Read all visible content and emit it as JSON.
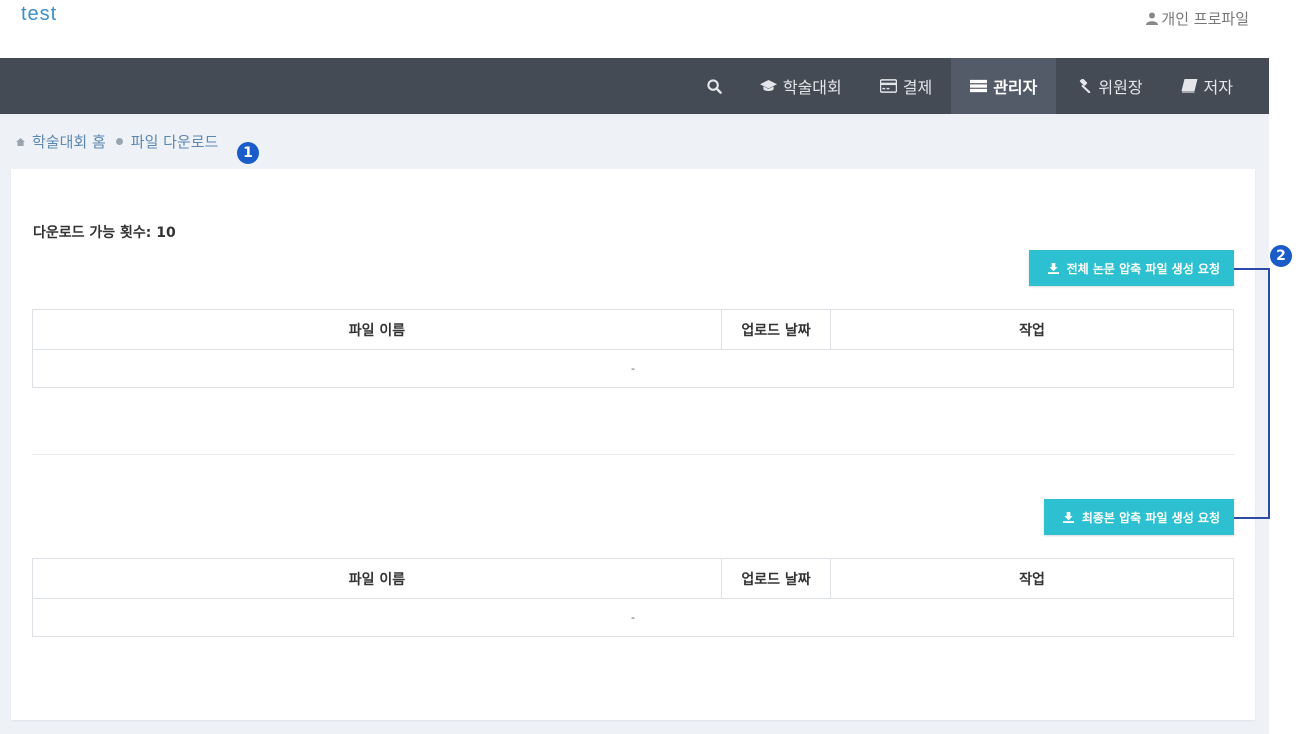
{
  "header": {
    "brand": "test",
    "profile_label": "개인 프로파일"
  },
  "nav": {
    "items": [
      {
        "label": "학술대회",
        "icon": "graduation-cap-icon"
      },
      {
        "label": "결제",
        "icon": "credit-card-icon"
      },
      {
        "label": "관리자",
        "icon": "server-icon",
        "active": true
      },
      {
        "label": "위원장",
        "icon": "gavel-icon"
      },
      {
        "label": "저자",
        "icon": "book-icon"
      }
    ]
  },
  "breadcrumb": {
    "home": "학술대회 홈",
    "current": "파일 다운로드"
  },
  "content": {
    "count_label": "다운로드 가능 횟수: 10",
    "section1": {
      "button_label": "전체 논문 압축 파일 생성 요청",
      "columns": [
        "파일 이름",
        "업로드 날짜",
        "작업"
      ],
      "empty_cell": "-"
    },
    "section2": {
      "button_label": "최종본 압축 파일 생성 요청",
      "columns": [
        "파일 이름",
        "업로드 날짜",
        "작업"
      ],
      "empty_cell": "-"
    }
  },
  "annotations": {
    "marker1": "1",
    "marker2": "2"
  },
  "colors": {
    "navbar": "#444b55",
    "button": "#2cc0d1",
    "marker": "#1a5cc8"
  }
}
